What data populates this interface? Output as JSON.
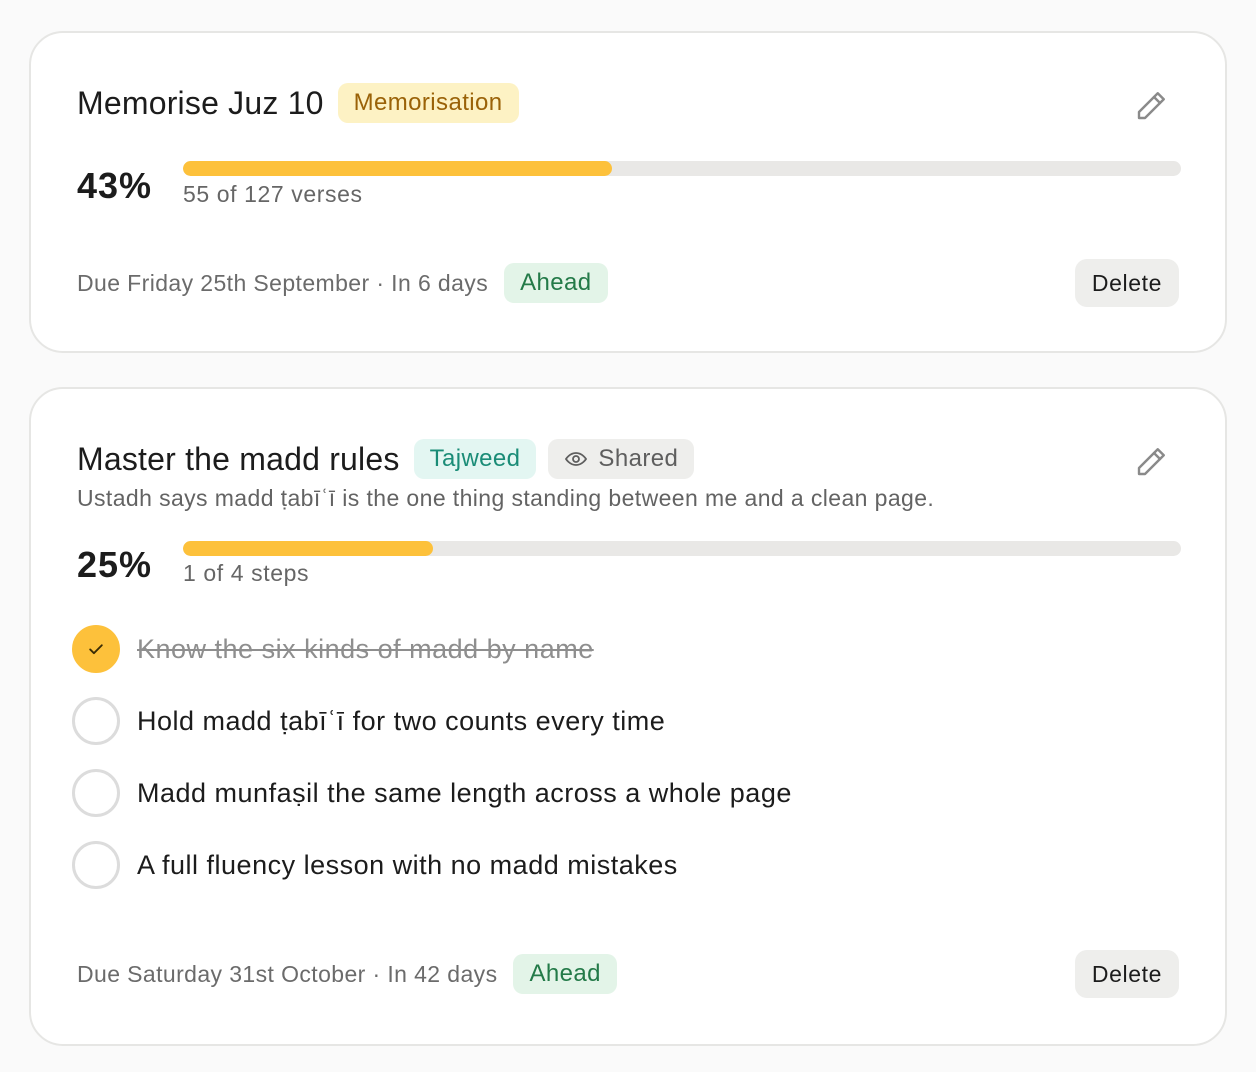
{
  "goals": [
    {
      "title": "Memorise Juz 10",
      "category": "Memorisation",
      "percent": "43%",
      "progress": 0.43,
      "progress_label": "55 of 127 verses",
      "due": "Due Friday 25th September · In 6 days",
      "status": "Ahead",
      "delete_label": "Delete",
      "edit_icon": "pencil-icon"
    },
    {
      "title": "Master the madd rules",
      "category": "Tajweed",
      "shared_label": "Shared",
      "shared_icon": "eye-icon",
      "note": "Ustadh says madd ṭabīʿī is the one thing standing between me and a clean page.",
      "percent": "25%",
      "progress": 0.25,
      "progress_label": "1 of 4 steps",
      "steps": [
        {
          "label": "Know the six kinds of madd by name",
          "done": true
        },
        {
          "label": "Hold madd ṭabīʿī for two counts every time",
          "done": false
        },
        {
          "label": "Madd munfaṣil the same length across a whole page",
          "done": false
        },
        {
          "label": "A full fluency lesson with no madd mistakes",
          "done": false
        }
      ],
      "due": "Due Saturday 31st October · In 42 days",
      "status": "Ahead",
      "delete_label": "Delete",
      "edit_icon": "pencil-icon"
    }
  ],
  "colors": {
    "accent": "#fdc13b",
    "track": "#e9e8e6",
    "ahead_bg": "#e3f4e8",
    "ahead_text": "#237a48"
  }
}
